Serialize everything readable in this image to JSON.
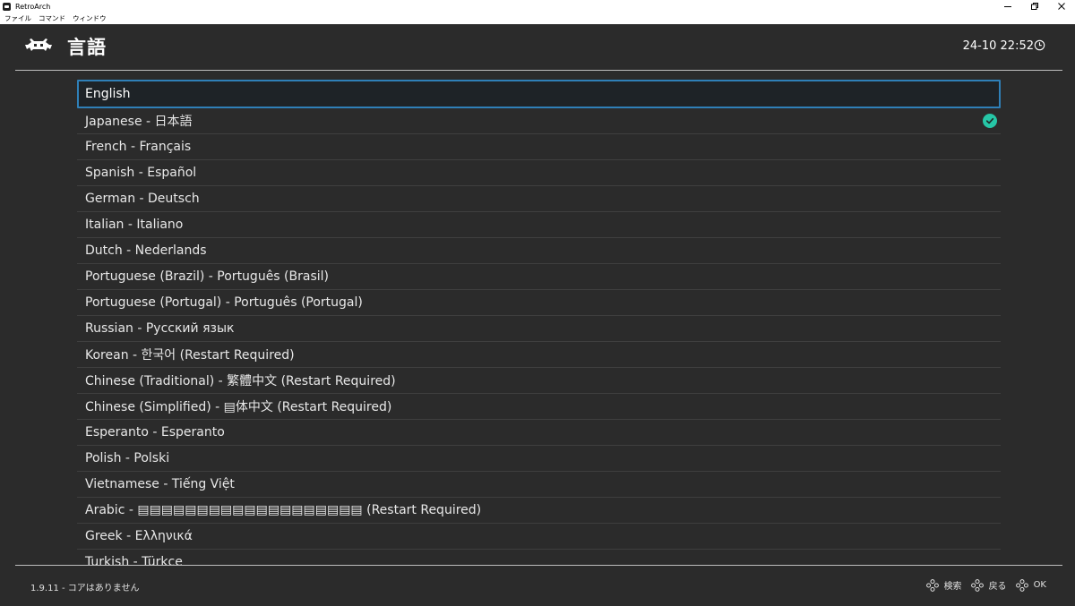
{
  "window": {
    "title": "RetroArch",
    "menu": [
      "ファイル",
      "コマンド",
      "ウィンドウ"
    ]
  },
  "header": {
    "title": "言語",
    "clock": "24-10 22:52"
  },
  "languages": [
    {
      "label": "English",
      "selected": true,
      "checked": false
    },
    {
      "label": "Japanese - 日本語",
      "selected": false,
      "checked": true
    },
    {
      "label": "French - Français"
    },
    {
      "label": "Spanish - Español"
    },
    {
      "label": "German - Deutsch"
    },
    {
      "label": "Italian - Italiano"
    },
    {
      "label": "Dutch - Nederlands"
    },
    {
      "label": "Portuguese (Brazil) - Português (Brasil)"
    },
    {
      "label": "Portuguese (Portugal) - Português (Portugal)"
    },
    {
      "label": "Russian - Русский язык"
    },
    {
      "label": "Korean - 한국어 (Restart Required)"
    },
    {
      "label": "Chinese (Traditional) - 繁體中文 (Restart Required)"
    },
    {
      "label": "Chinese (Simplified) - ▤体中文 (Restart Required)"
    },
    {
      "label": "Esperanto - Esperanto"
    },
    {
      "label": "Polish - Polski"
    },
    {
      "label": "Vietnamese - Tiếng Việt"
    },
    {
      "label": "Arabic - ▤▤▤▤▤▤▤▤▤▤▤▤▤▤▤▤▤▤▤ (Restart Required)"
    },
    {
      "label": "Greek - Ελληνικά"
    },
    {
      "label": "Turkish - Türkçe"
    }
  ],
  "footer": {
    "info": "1.9.11 - コアはありません",
    "actions": [
      {
        "icon": "gamepad-button-icon",
        "label": "検索"
      },
      {
        "icon": "gamepad-button-icon",
        "label": "戻る"
      },
      {
        "icon": "gamepad-button-icon",
        "label": "OK"
      }
    ]
  },
  "colors": {
    "background": "#2b2b2b",
    "selection_border": "#2f80b8",
    "check": "#26c6a6"
  }
}
